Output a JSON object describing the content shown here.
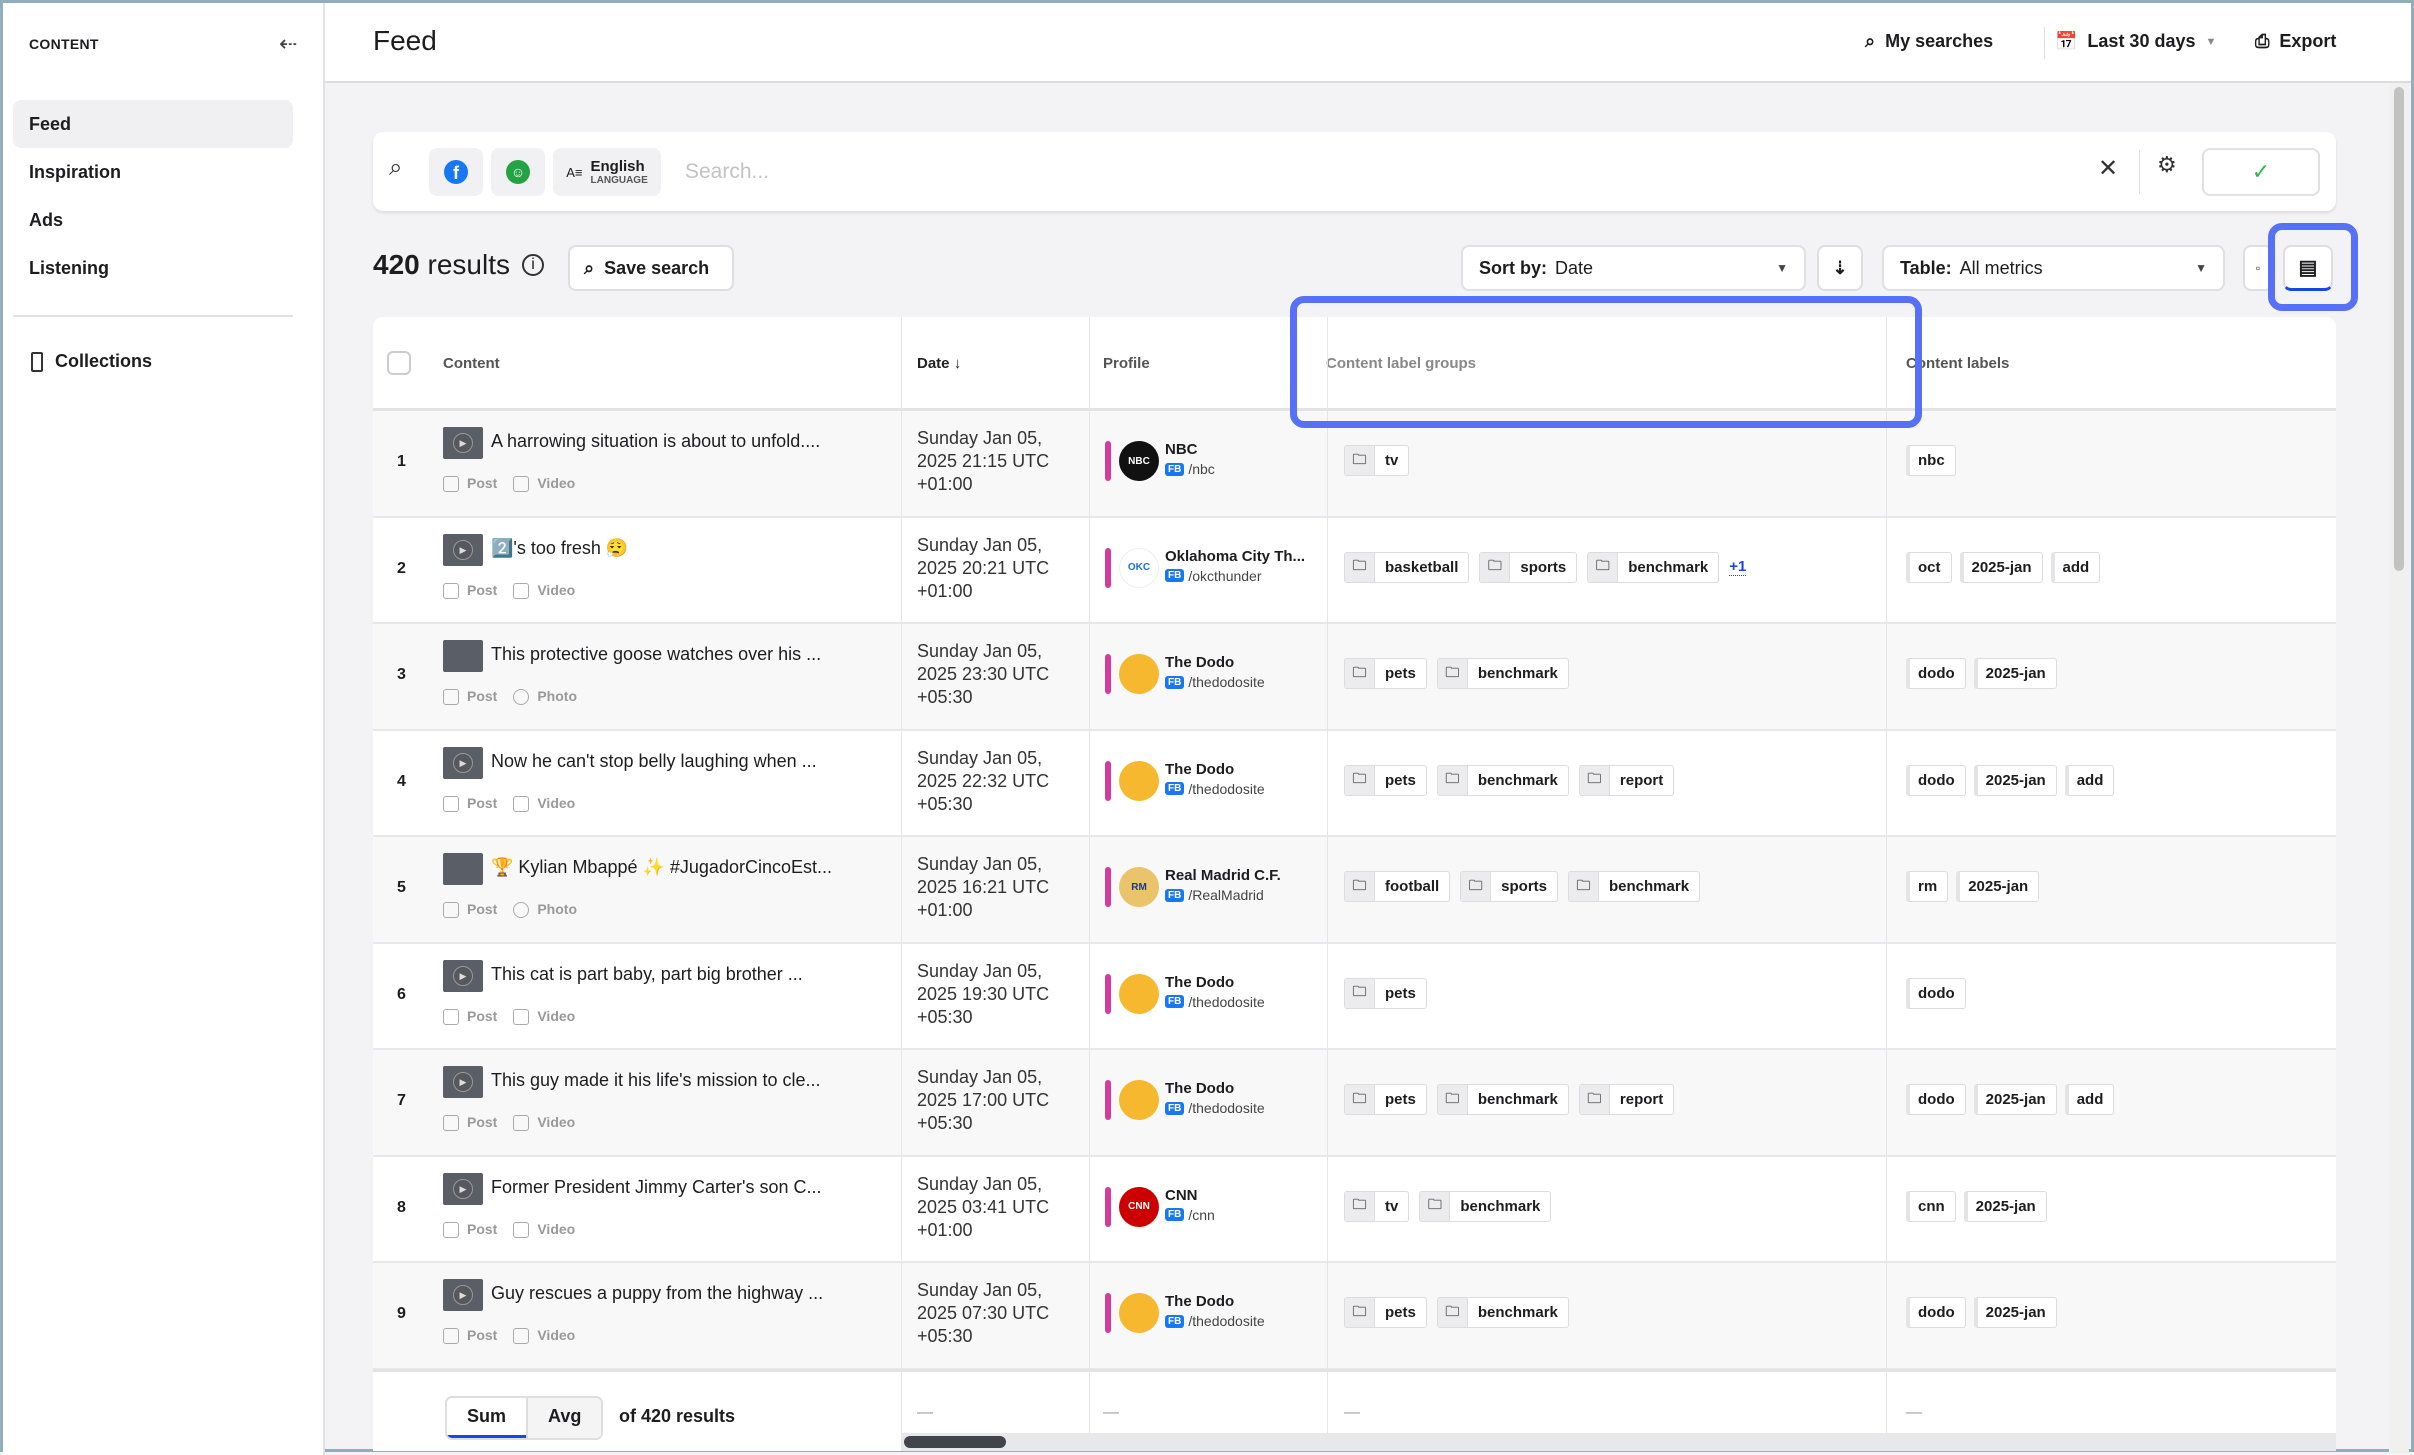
{
  "sidebar": {
    "title": "CONTENT",
    "items": [
      {
        "label": "Feed",
        "active": true
      },
      {
        "label": "Inspiration"
      },
      {
        "label": "Ads"
      },
      {
        "label": "Listening"
      }
    ],
    "collections": "Collections"
  },
  "header": {
    "title": "Feed",
    "my_searches": "My searches",
    "date_range": "Last 30 days",
    "export": "Export"
  },
  "search": {
    "placeholder": "Search...",
    "language": "English",
    "language_caption": "LANGUAGE",
    "platforms": [
      "facebook-icon",
      "green-chat-icon"
    ]
  },
  "toolbar": {
    "results_count": "420",
    "results_word": "results",
    "save_search": "Save search",
    "sort_label": "Sort by:",
    "sort_value": "Date",
    "table_label": "Table:",
    "table_value": "All metrics"
  },
  "table": {
    "columns": [
      "Content",
      "Date",
      "Profile",
      "Content label groups",
      "Content labels"
    ],
    "sort_arrow": "↓",
    "rows": [
      {
        "num": "1",
        "text": "A harrowing situation is about to unfold....",
        "type": "Post",
        "media": "Video",
        "date": [
          "Sunday Jan 05,",
          "2025 21:15 UTC",
          "+01:00"
        ],
        "profile": "NBC",
        "handle": "/nbc",
        "platform": "FB",
        "avatar": "NBC",
        "avatar_color": "#111111",
        "groups": [
          "tv"
        ],
        "more": "",
        "labels": [
          "nbc"
        ]
      },
      {
        "num": "2",
        "text": "2️⃣'s too fresh 😮‍💨",
        "type": "Post",
        "media": "Video",
        "date": [
          "Sunday Jan 05,",
          "2025 20:21 UTC",
          "+01:00"
        ],
        "profile": "Oklahoma City Th...",
        "handle": "/okcthunder",
        "platform": "FB",
        "avatar": "OKC",
        "avatar_color": "#ffffff",
        "groups": [
          "basketball",
          "sports",
          "benchmark"
        ],
        "more": "+1",
        "labels": [
          "oct",
          "2025-jan",
          "add"
        ]
      },
      {
        "num": "3",
        "text": "This protective goose watches over his ...",
        "type": "Post",
        "media": "Photo",
        "date": [
          "Sunday Jan 05,",
          "2025 23:30 UTC",
          "+05:30"
        ],
        "profile": "The Dodo",
        "handle": "/thedodosite",
        "platform": "FB",
        "avatar": "",
        "avatar_color": "#f5b82e",
        "groups": [
          "pets",
          "benchmark"
        ],
        "more": "",
        "labels": [
          "dodo",
          "2025-jan"
        ]
      },
      {
        "num": "4",
        "text": "Now he can't stop belly laughing when ...",
        "type": "Post",
        "media": "Video",
        "date": [
          "Sunday Jan 05,",
          "2025 22:32 UTC",
          "+05:30"
        ],
        "profile": "The Dodo",
        "handle": "/thedodosite",
        "platform": "FB",
        "avatar": "",
        "avatar_color": "#f5b82e",
        "groups": [
          "pets",
          "benchmark",
          "report"
        ],
        "more": "",
        "labels": [
          "dodo",
          "2025-jan",
          "add"
        ]
      },
      {
        "num": "5",
        "text": "🏆 Kylian Mbappé ✨ #JugadorCincoEst...",
        "type": "Post",
        "media": "Photo",
        "date": [
          "Sunday Jan 05,",
          "2025 16:21 UTC",
          "+01:00"
        ],
        "profile": "Real Madrid C.F.",
        "handle": "/RealMadrid",
        "platform": "FB",
        "avatar": "RM",
        "avatar_color": "#e9c46a",
        "groups": [
          "football",
          "sports",
          "benchmark"
        ],
        "more": "",
        "labels": [
          "rm",
          "2025-jan"
        ]
      },
      {
        "num": "6",
        "text": "This cat is part baby, part big brother ...",
        "type": "Post",
        "media": "Video",
        "date": [
          "Sunday Jan 05,",
          "2025 19:30 UTC",
          "+05:30"
        ],
        "profile": "The Dodo",
        "handle": "/thedodosite",
        "platform": "FB",
        "avatar": "",
        "avatar_color": "#f5b82e",
        "groups": [
          "pets"
        ],
        "more": "",
        "labels": [
          "dodo"
        ]
      },
      {
        "num": "7",
        "text": "This guy made it his life's mission to cle...",
        "type": "Post",
        "media": "Video",
        "date": [
          "Sunday Jan 05,",
          "2025 17:00 UTC",
          "+05:30"
        ],
        "profile": "The Dodo",
        "handle": "/thedodosite",
        "platform": "FB",
        "avatar": "",
        "avatar_color": "#f5b82e",
        "groups": [
          "pets",
          "benchmark",
          "report"
        ],
        "more": "",
        "labels": [
          "dodo",
          "2025-jan",
          "add"
        ]
      },
      {
        "num": "8",
        "text": "Former President Jimmy Carter's son C...",
        "type": "Post",
        "media": "Video",
        "date": [
          "Sunday Jan 05,",
          "2025 03:41 UTC",
          "+01:00"
        ],
        "profile": "CNN",
        "handle": "/cnn",
        "platform": "FB",
        "avatar": "CNN",
        "avatar_color": "#cc0000",
        "groups": [
          "tv",
          "benchmark"
        ],
        "more": "",
        "labels": [
          "cnn",
          "2025-jan"
        ]
      },
      {
        "num": "9",
        "text": "Guy rescues a puppy from the highway ...",
        "type": "Post",
        "media": "Video",
        "date": [
          "Sunday Jan 05,",
          "2025 07:30 UTC",
          "+05:30"
        ],
        "profile": "The Dodo",
        "handle": "/thedodosite",
        "platform": "FB",
        "avatar": "",
        "avatar_color": "#f5b82e",
        "groups": [
          "pets",
          "benchmark"
        ],
        "more": "",
        "labels": [
          "dodo",
          "2025-jan"
        ]
      }
    ],
    "footer": {
      "sum": "Sum",
      "avg": "Avg",
      "of_results": "of 420 results",
      "empty": "—"
    }
  },
  "colors": {
    "accent": "#1747e6",
    "highlight": "#5670f7",
    "profile_bar": "#d43c9c",
    "confirm": "#2fb84d"
  }
}
